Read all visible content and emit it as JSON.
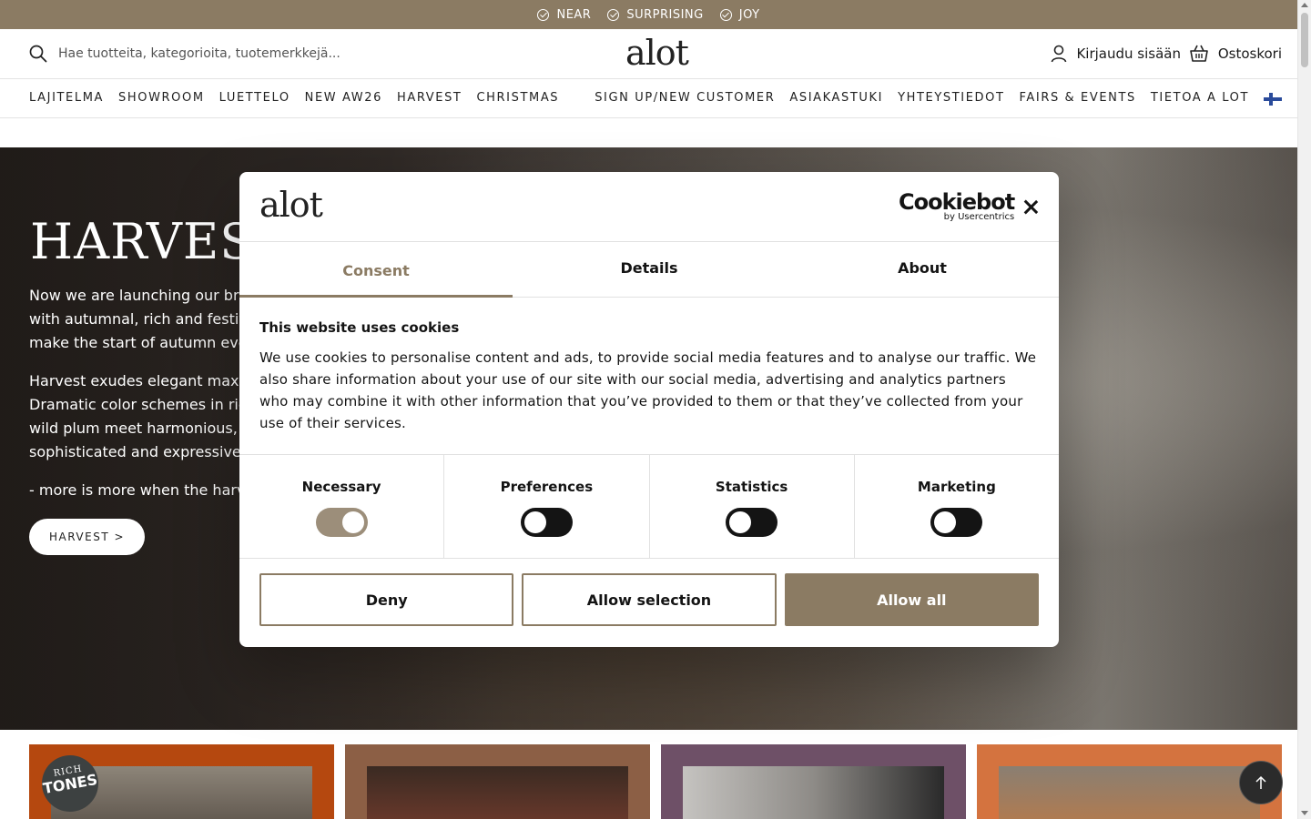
{
  "topbar": {
    "usps": [
      "NEAR",
      "SURPRISING",
      "JOY"
    ]
  },
  "header": {
    "logo": "alot",
    "search_placeholder": "Hae tuotteita, kategorioita, tuotemerkkejä...",
    "login_label": "Kirjaudu sisään",
    "cart_label": "Ostoskori"
  },
  "nav": {
    "left": [
      "LAJITELMA",
      "SHOWROOM",
      "LUETTELO",
      "NEW AW26",
      "HARVEST",
      "CHRISTMAS"
    ],
    "right": [
      "SIGN UP/NEW CUSTOMER",
      "ASIAKASTUKI",
      "YHTEYSTIEDOT",
      "FAIRS & EVENTS",
      "TIETOA A LOT"
    ]
  },
  "hero": {
    "title": "HARVEST",
    "para1_lines": [
      "Now we are launching our bran",
      "with autumnal, rich and festive",
      "make the start of autumn even"
    ],
    "para2_lines": [
      "Harvest exudes elegant maxim",
      "Dramatic color schemes in rich",
      "wild plum meet harmonious, w",
      "sophisticated and expressive"
    ],
    "para3": "- more is more when the harve",
    "button_label": "HARVEST >"
  },
  "tiles": {
    "badge_line1": "RICH",
    "badge_line2": "TONES",
    "colors": [
      "#b5480f",
      "#8c5f45",
      "#6e5067",
      "#d4733f"
    ]
  },
  "modal": {
    "logo": "alot",
    "provider_name": "Cookiebot",
    "provider_sub": "by Usercentrics",
    "tabs": [
      "Consent",
      "Details",
      "About"
    ],
    "heading": "This website uses cookies",
    "body": "We use cookies to personalise content and ads, to provide social media features and to analyse our traffic. We also share information about your use of our site with our social media, advertising and analytics partners who may combine it with other information that you’ve provided to them or that they’ve collected from your use of their services.",
    "categories": [
      {
        "label": "Necessary",
        "state": "on-disabled"
      },
      {
        "label": "Preferences",
        "state": "off"
      },
      {
        "label": "Statistics",
        "state": "off"
      },
      {
        "label": "Marketing",
        "state": "off"
      }
    ],
    "buttons": {
      "deny": "Deny",
      "allow_selection": "Allow selection",
      "allow_all": "Allow all"
    }
  },
  "colors": {
    "accent": "#8b7b63",
    "dark": "#141414"
  }
}
